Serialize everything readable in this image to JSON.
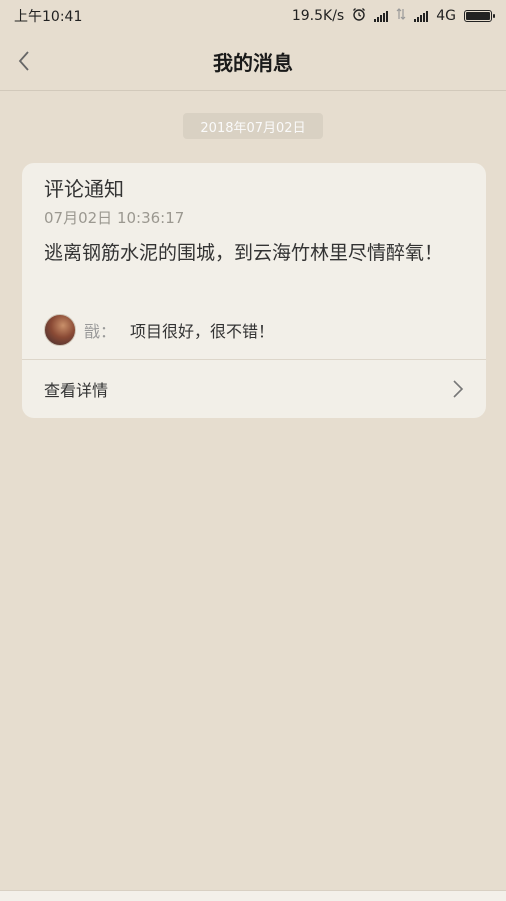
{
  "status_bar": {
    "time": "上午10:41",
    "net_speed": "19.5K/s",
    "network": "4G",
    "icons": [
      "alarm-icon",
      "signal-icon",
      "signal-2-icon",
      "battery-icon"
    ]
  },
  "header": {
    "title": "我的消息",
    "back_icon": "chevron-left-icon"
  },
  "date_chip": "2018年07月02日",
  "card": {
    "title": "评论通知",
    "time": "07月02日 10:36:17",
    "body": "逃离钢筋水泥的围城，到云海竹林里尽情醉氧！",
    "comment": {
      "user": "戩",
      "colon": "：",
      "text": "项目很好，很不错！"
    },
    "detail_label": "查看详情",
    "detail_icon": "chevron-right-icon"
  },
  "colors": {
    "background": "#e6ddcf",
    "card": "#f2efe8",
    "chip": "#d9d1c3"
  }
}
